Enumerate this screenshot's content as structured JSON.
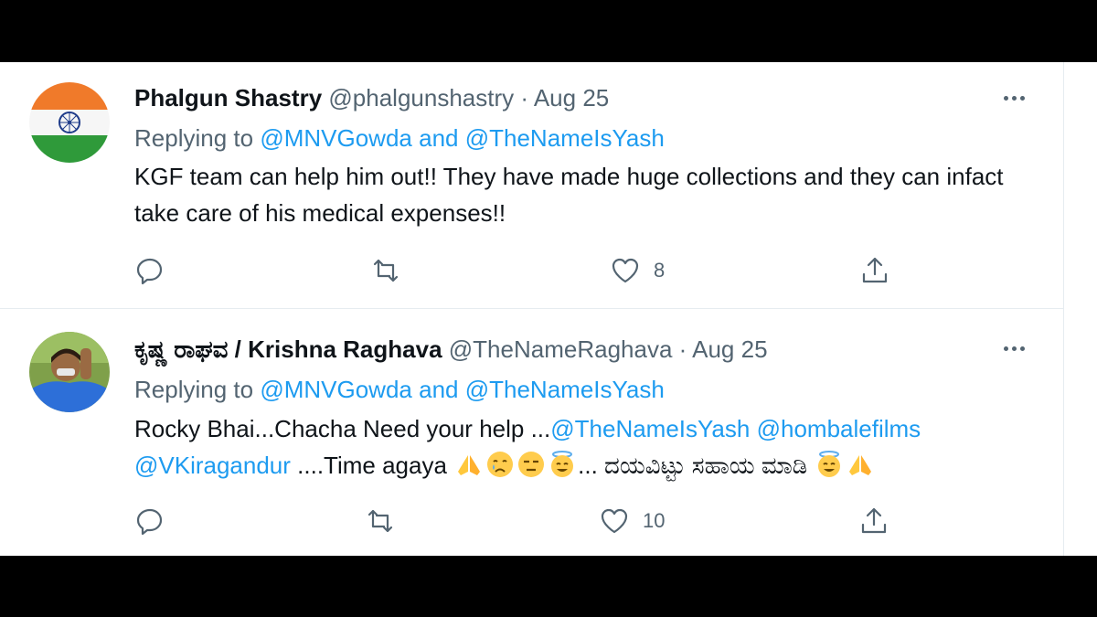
{
  "tweets": [
    {
      "name": "Phalgun Shastry",
      "handle": "@phalgunshastry",
      "dot": "·",
      "date": "Aug 25",
      "replying_prefix": "Replying to",
      "reply_to_1": "@MNVGowda",
      "reply_and": "and",
      "reply_to_2": "@TheNameIsYash",
      "text": "KGF team can help him out!! They have made huge collections and they can infact take care of his medical expenses!!",
      "likes": "8",
      "avatar_icon": "india-flag-avatar"
    },
    {
      "name": "ಕೃಷ್ಣ ರಾಘವ / Krishna Raghava",
      "handle": "@TheNameRaghava",
      "dot": "·",
      "date": "Aug 25",
      "replying_prefix": "Replying to",
      "reply_to_1": "@MNVGowda",
      "reply_and": "and",
      "reply_to_2": "@TheNameIsYash",
      "text_1": "Rocky Bhai...Chacha Need your help ...",
      "mention_1": "@TheNameIsYash",
      "mention_2": "@hombalefilms",
      "mention_3": "@VKiragandur",
      "text_2": " ....Time agaya ",
      "text_3": "... ದಯವಿಟ್ಟು ಸಹಾಯ ಮಾಡಿ ",
      "likes": "10",
      "avatar_icon": "person-photo-avatar"
    }
  ],
  "colors": {
    "link": "#1d9bf0",
    "secondary": "#536471",
    "text": "#0f1419"
  }
}
